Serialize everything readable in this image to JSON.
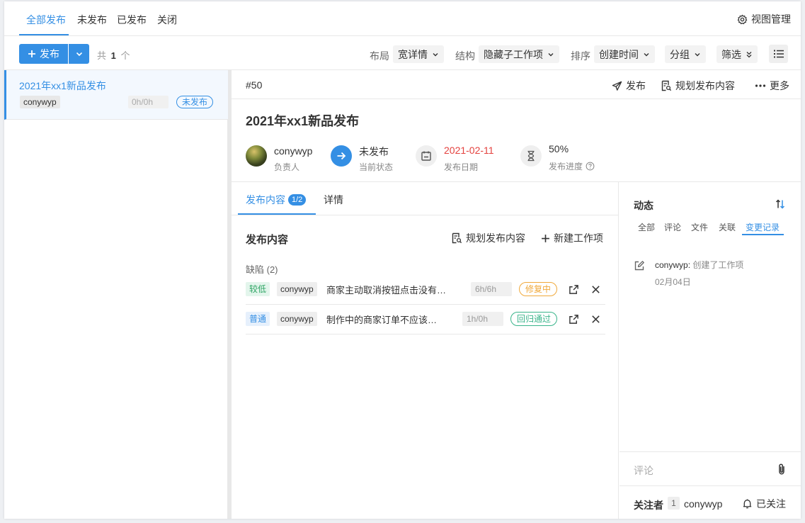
{
  "top_tabs": [
    {
      "label": "全部发布",
      "active": true
    },
    {
      "label": "未发布",
      "active": false
    },
    {
      "label": "已发布",
      "active": false
    },
    {
      "label": "关闭",
      "active": false
    }
  ],
  "view_manage_label": "视图管理",
  "toolbar": {
    "publish_label": "发布",
    "count_prefix": "共",
    "count_value": "1",
    "count_suffix": "个",
    "layout_label": "布局",
    "layout_value": "宽详情",
    "structure_label": "结构",
    "structure_value": "隐藏子工作项",
    "sort_label": "排序",
    "sort_value": "创建时间",
    "group_label": "分组",
    "filter_label": "筛选"
  },
  "release_list": [
    {
      "title": "2021年xx1新品发布",
      "owner": "conywyp",
      "hours": "0h/0h",
      "status": "未发布"
    }
  ],
  "detail": {
    "id": "#50",
    "actions": {
      "publish": "发布",
      "plan": "规划发布内容",
      "more": "更多"
    },
    "title": "2021年xx1新品发布",
    "owner_name": "conywyp",
    "owner_label": "负责人",
    "state_value": "未发布",
    "state_label": "当前状态",
    "date_value": "2021-02-11",
    "date_label": "发布日期",
    "progress_value": "50%",
    "progress_label": "发布进度"
  },
  "content": {
    "tabs": {
      "content_label": "发布内容",
      "content_badge": "1/2",
      "details_label": "详情"
    },
    "section_title": "发布内容",
    "plan_label": "规划发布内容",
    "new_label": "新建工作项",
    "group_label": "缺陷 (2)",
    "items": [
      {
        "priority": "较低",
        "owner": "conywyp",
        "title": "商家主动取消按钮点击没有…",
        "hours": "6h/6h",
        "status": "修复中"
      },
      {
        "priority": "普通",
        "owner": "conywyp",
        "title": "制作中的商家订单不应该…",
        "hours": "1h/0h",
        "status": "回归通过"
      }
    ]
  },
  "activity": {
    "title": "动态",
    "tabs": [
      "全部",
      "评论",
      "文件",
      "关联",
      "变更记录"
    ],
    "active_tab": "变更记录",
    "log_user": "conywyp:",
    "log_action": "创建了工作项",
    "log_time": "02月04日",
    "comment_placeholder": "评论",
    "followers_label": "关注者",
    "followers_count": "1",
    "follower_name": "conywyp",
    "followed_label": "已关注"
  },
  "colors": {
    "accent": "#348fe4",
    "date_red": "#e4423f",
    "prio_low_bg": "#e3f5ec",
    "prio_low_fg": "#2fa564",
    "prio_normal_bg": "#e6f0fc",
    "prio_normal_fg": "#348fe4",
    "status_fixing": "#f0a93b",
    "status_passed": "#39b48a"
  }
}
